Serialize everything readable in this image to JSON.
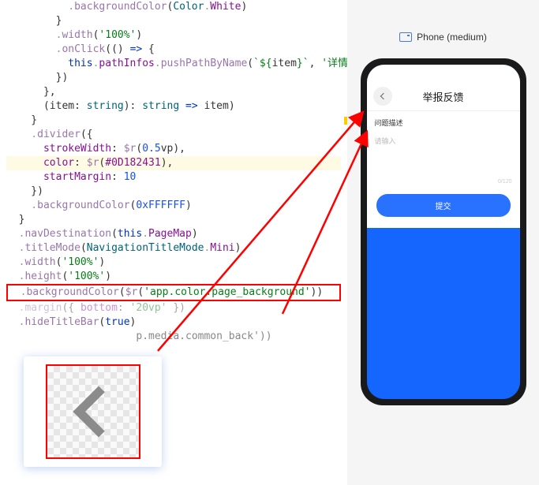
{
  "code": {
    "l1": "          .backgroundColor(Color.White)",
    "l2": "        }",
    "l3": "        .width('100%')",
    "l4": "        .onClick(() => {",
    "l5": "          this.pathInfos.pushPathByName(`${item}`, '详情页面参数')",
    "l6": "        })",
    "l7": "      },",
    "l8": "      (item: string): string => item)",
    "l9": "    }",
    "l10": "    .divider({",
    "l11": "      strokeWidth: $r(0.5vp),",
    "l12": "      color: $r(#0D182431),",
    "l13": "      startMargin: 10",
    "l14": "    })",
    "l15": "    .backgroundColor(0xFFFFFF)",
    "l16": "  }",
    "l17": "  .navDestination(this.PageMap)",
    "l18": "  .titleMode(NavigationTitleMode.Mini)",
    "l19": "  .width('100%')",
    "l20": "  .height('100%')",
    "l21": "  .backgroundColor($r('app.color.page_background'))",
    "l22": "  .margin({ bottom: '20vp' })",
    "l23": "  .hideTitleBar(true)",
    "l24_suffix": "p.media.common_back'))"
  },
  "preview": {
    "device_label": "Phone (medium)",
    "screen": {
      "title": "举报反馈",
      "section_label": "问题描述",
      "placeholder": "请输入",
      "char_count": "0/120",
      "submit": "提交"
    }
  }
}
